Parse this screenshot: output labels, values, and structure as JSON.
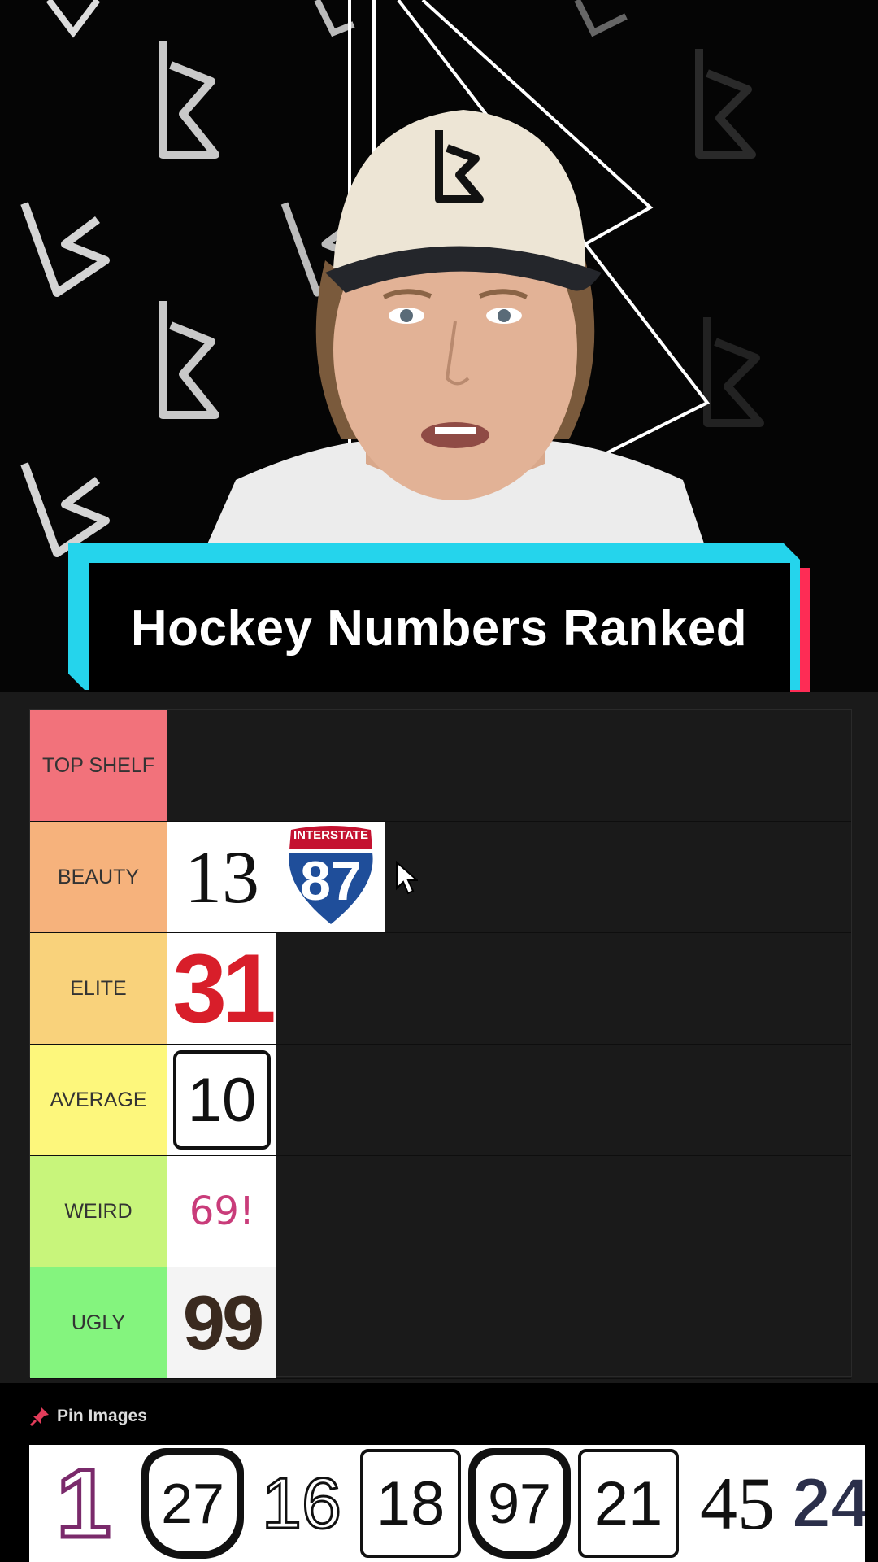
{
  "banner": {
    "title": "Hockey Numbers Ranked"
  },
  "colors": {
    "banner_cyan": "#25d4ec",
    "banner_red": "#fe2c55",
    "panel_bg": "#1a1a1a"
  },
  "tiers": [
    {
      "label": "TOP SHELF",
      "color": "#f2727b",
      "items": []
    },
    {
      "label": "BEAUTY",
      "color": "#f6b27c",
      "items": [
        "13",
        "87"
      ]
    },
    {
      "label": "ELITE",
      "color": "#f9d27b",
      "items": [
        "31"
      ]
    },
    {
      "label": "AVERAGE",
      "color": "#fdf77c",
      "items": [
        "10"
      ]
    },
    {
      "label": "WEIRD",
      "color": "#c8f57b",
      "items": [
        "69!"
      ]
    },
    {
      "label": "UGLY",
      "color": "#84f47e",
      "items": [
        "99"
      ]
    }
  ],
  "tile_extras": {
    "interstate_text": "INTERSTATE"
  },
  "pin": {
    "icon": "pin-icon",
    "label": "Pin Images"
  },
  "pool": [
    "1",
    "27",
    "16",
    "18",
    "97",
    "21",
    "45",
    "24"
  ]
}
